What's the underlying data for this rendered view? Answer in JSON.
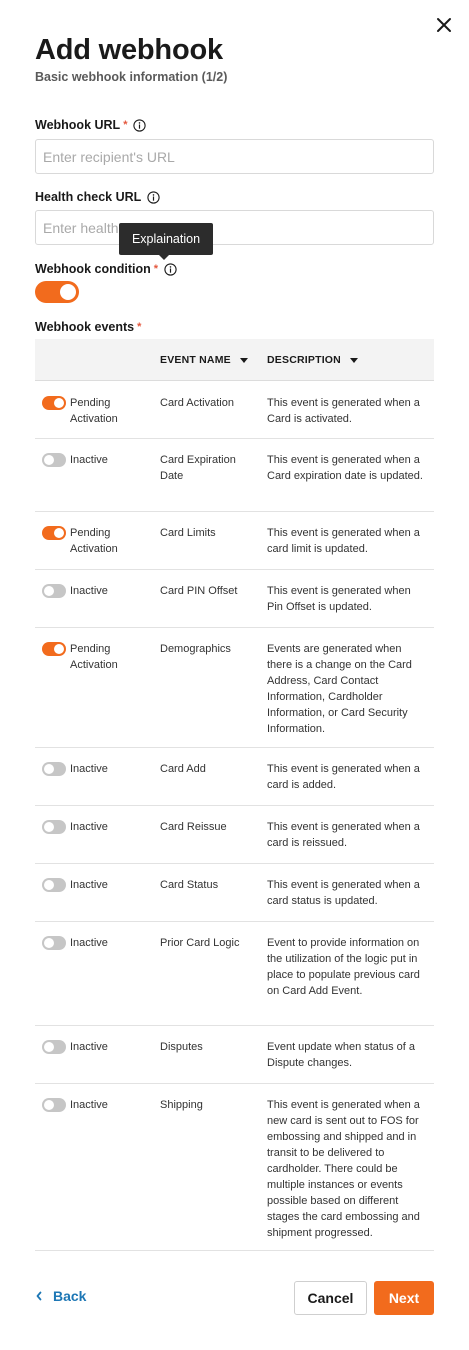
{
  "dialog": {
    "title": "Add webhook",
    "subtitle": "Basic webhook information (1/2)"
  },
  "fields": {
    "webhook_url": {
      "label": "Webhook URL",
      "required_mark": "*",
      "placeholder": "Enter recipient's URL",
      "value": ""
    },
    "health_check_url": {
      "label": "Health check URL",
      "placeholder": "Enter health check URL",
      "value": ""
    },
    "webhook_condition": {
      "label": "Webhook condition",
      "required_mark": "*",
      "enabled": true
    },
    "webhook_events": {
      "label": "Webhook events",
      "required_mark": "*"
    }
  },
  "tooltip": {
    "text": "Explaination"
  },
  "table": {
    "columns": {
      "event_name": "EVENT NAME",
      "description": "DESCRIPTION"
    },
    "rows": [
      {
        "enabled": true,
        "status": "Pending Activation",
        "name": "Card Activation",
        "description": "This event is generated when a Card is activated."
      },
      {
        "enabled": false,
        "status": "Inactive",
        "name": "Card Expiration Date",
        "description": "This event is generated when a Card expiration date is updated."
      },
      {
        "enabled": true,
        "status": "Pending Activation",
        "name": "Card Limits",
        "description": "This event is generated when a card limit is updated."
      },
      {
        "enabled": false,
        "status": "Inactive",
        "name": "Card PIN Offset",
        "description": "This event is generated when Pin Offset is updated."
      },
      {
        "enabled": true,
        "status": "Pending Activation",
        "name": "Demographics",
        "description": "Events are generated when there is a change on the Card Address, Card Contact Information, Cardholder Information, or Card Security Information."
      },
      {
        "enabled": false,
        "status": "Inactive",
        "name": "Card Add",
        "description": "This event is generated when a card is added."
      },
      {
        "enabled": false,
        "status": "Inactive",
        "name": "Card Reissue",
        "description": "This event is generated when a card is reissued."
      },
      {
        "enabled": false,
        "status": "Inactive",
        "name": "Card Status",
        "description": "This event is generated when a card status is updated."
      },
      {
        "enabled": false,
        "status": "Inactive",
        "name": "Prior Card Logic",
        "description": "Event to provide information on the utilization of the logic put in place to populate previous card on Card Add Event."
      },
      {
        "enabled": false,
        "status": "Inactive",
        "name": "Disputes",
        "description": "Event update when status of a Dispute changes."
      },
      {
        "enabled": false,
        "status": "Inactive",
        "name": "Shipping",
        "description": "This event is generated when a new card is sent out to FOS for embossing and shipped and in transit to be delivered to cardholder. There could be multiple instances or events possible based on different stages the card embossing and shipment progressed."
      }
    ]
  },
  "footer": {
    "back_label": "Back",
    "cancel_label": "Cancel",
    "next_label": "Next"
  },
  "colors": {
    "accent": "#f26b1d",
    "link": "#1d77b5",
    "toggle_off": "#c6c6c6"
  }
}
